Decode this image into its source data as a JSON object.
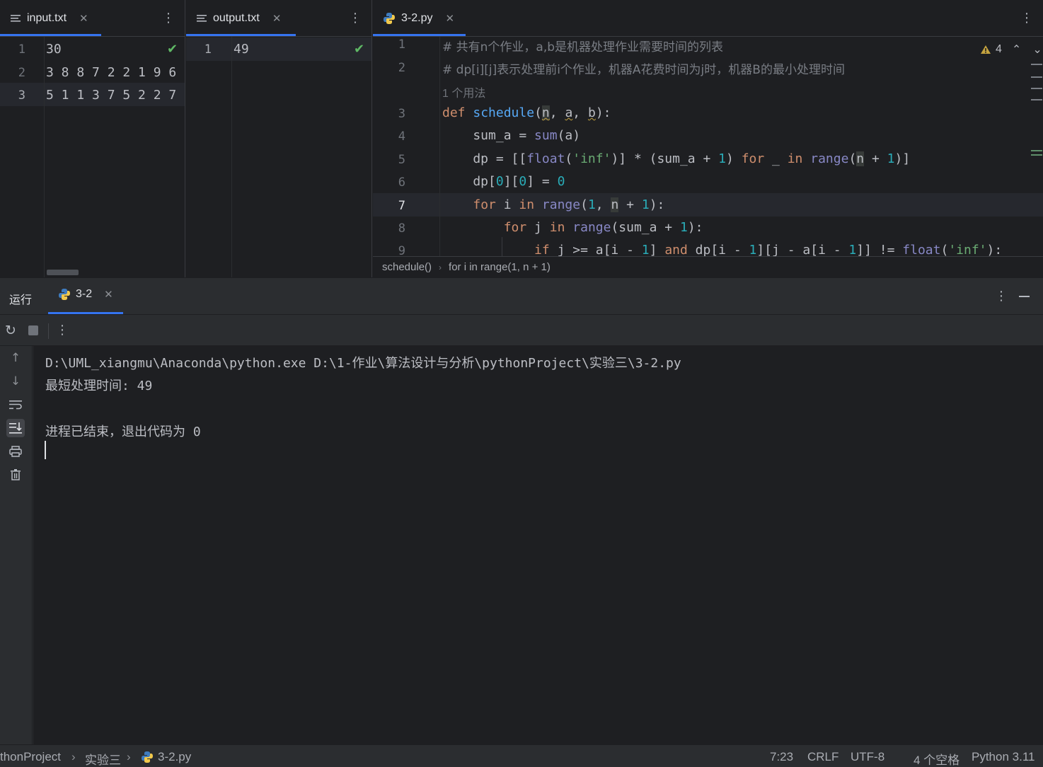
{
  "editors": {
    "input": {
      "tab_label": "input.txt",
      "lines": [
        "30",
        "3 8 8 7 2 2 1 9 6",
        "5 1 1 3 7 5 2 2 7"
      ],
      "line_numbers": [
        "1",
        "2",
        "3"
      ]
    },
    "output": {
      "tab_label": "output.txt",
      "lines": [
        "49"
      ],
      "line_numbers": [
        "1"
      ]
    },
    "code": {
      "tab_label": "3-2.py",
      "warning_count": "4",
      "line_numbers": [
        "1",
        "2",
        "3",
        "4",
        "5",
        "6",
        "7",
        "8",
        "9"
      ],
      "usage_hint": "1 个用法",
      "comment1": "# 共有n个作业，a,b是机器处理作业需要时间的列表",
      "comment2": "# dp[i][j]表示处理前i个作业，机器A花费时间为j时，机器B的最小处理时间",
      "breadcrumb": [
        "schedule()",
        "for i in range(1, n + 1)"
      ]
    }
  },
  "run": {
    "title": "运行",
    "tab_label": "3-2",
    "console": {
      "command": "D:\\UML_xiangmu\\Anaconda\\python.exe D:\\1-作业\\算法设计与分析\\pythonProject\\实验三\\3-2.py",
      "result": "最短处理时间: 49",
      "exit": "进程已结束，退出代码为 0"
    }
  },
  "statusbar": {
    "path": [
      "thonProject",
      "实验三",
      "3-2.py"
    ],
    "position": "7:23",
    "line_ending": "CRLF",
    "encoding": "UTF-8",
    "indent": "4 个空格",
    "interpreter": "Python 3.11"
  },
  "colors": {
    "accent": "#3574f0",
    "check": "#5fb865",
    "keyword": "#cf8e6d",
    "function": "#56a8f5",
    "number": "#2aacb8",
    "string": "#6aab73"
  }
}
